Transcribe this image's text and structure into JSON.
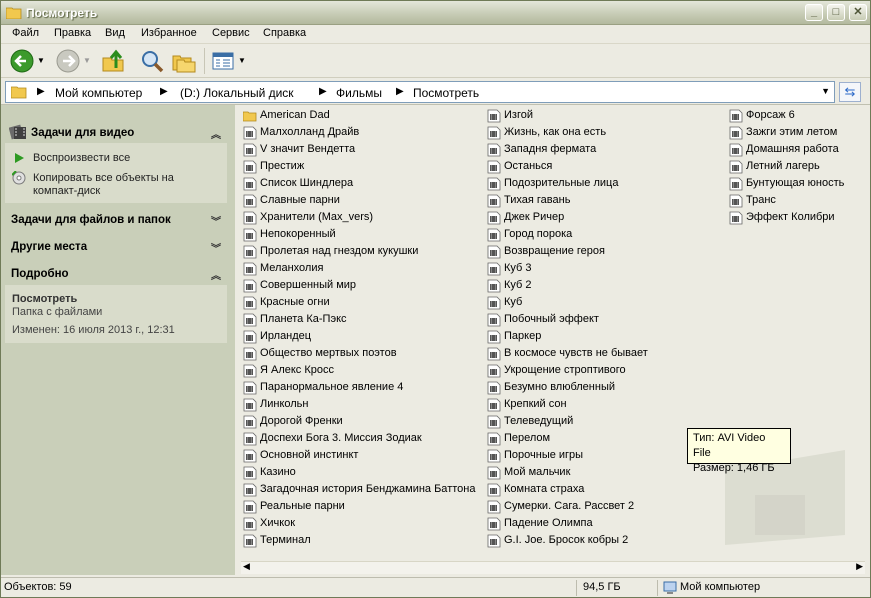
{
  "window": {
    "title": "Посмотреть"
  },
  "menu": [
    "Файл",
    "Правка",
    "Вид",
    "Избранное",
    "Сервис",
    "Справка"
  ],
  "address": {
    "crumbs": [
      "Мой компьютер",
      "(D:) Локальный диск",
      "Фильмы",
      "Посмотреть"
    ]
  },
  "left_panel": {
    "video_tasks": {
      "title": "Задачи для видео",
      "items": [
        "Воспроизвести все",
        "Копировать все объекты на",
        "компакт-диск"
      ]
    },
    "file_tasks": {
      "title": "Задачи для файлов и папок"
    },
    "other_places": {
      "title": "Другие места"
    },
    "details": {
      "title": "Подробно",
      "name": "Посмотреть",
      "type": "Папка с файлами",
      "modified": "Изменен: 16 июля 2013 г., 12:31"
    }
  },
  "files": {
    "col1": [
      "American Dad",
      "Малхолланд Драйв",
      "V значит Вендетта",
      "Престиж",
      "Список Шиндлера",
      "Славные парни",
      "Хранители (Max_vers)",
      "Непокоренный",
      "Пролетая над гнездом кукушки",
      "Меланхолия",
      "Совершенный мир",
      "Красные огни",
      "Планета Ка-Пэкс",
      "Ирландец",
      "Общество мертвых поэтов",
      "Я Алекс Кросс",
      "Паранормальное явление 4",
      "Линкольн",
      "Дорогой Френки",
      "Доспехи Бога 3. Миссия Зодиак",
      "Основной инстинкт",
      "Казино",
      "Загадочная история Бенджамина Баттона",
      "Реальные парни",
      "Хичкок",
      "Терминал"
    ],
    "col2": [
      "Изгой",
      "Жизнь, как она есть",
      "Западня ферматa",
      "Останься",
      "Подозрительные лица",
      "Тихая гавань",
      "Джек Ричер",
      "Город порока",
      "Возвращение героя",
      "Куб 3",
      "Куб 2",
      "Куб",
      "Побочный эффект",
      "Паркер",
      "В космосе чувств не бывает",
      "Укрощение строптивого",
      "Безумно влюбленный",
      "Крепкий сон",
      "Телеведущий",
      "Перелом",
      "Порочные игры",
      "Мой мальчик",
      "Комната страха",
      "Сумерки. Сага. Рассвет 2",
      "Падение Олимпа",
      "G.I. Joe. Бросок кобры 2"
    ],
    "col3": [
      "Форсаж 6",
      "Зажги этим летом",
      "Домашняя работа",
      "Летний лагерь",
      "Бунтующая юность",
      "Транс",
      "Эффект Колибри"
    ]
  },
  "tooltip": {
    "line1": "Тип: AVI Video File",
    "line2": "Размер: 1,46 ГБ"
  },
  "status": {
    "count": "Объектов: 59",
    "size": "94,5 ГБ",
    "location": "Мой компьютер"
  }
}
